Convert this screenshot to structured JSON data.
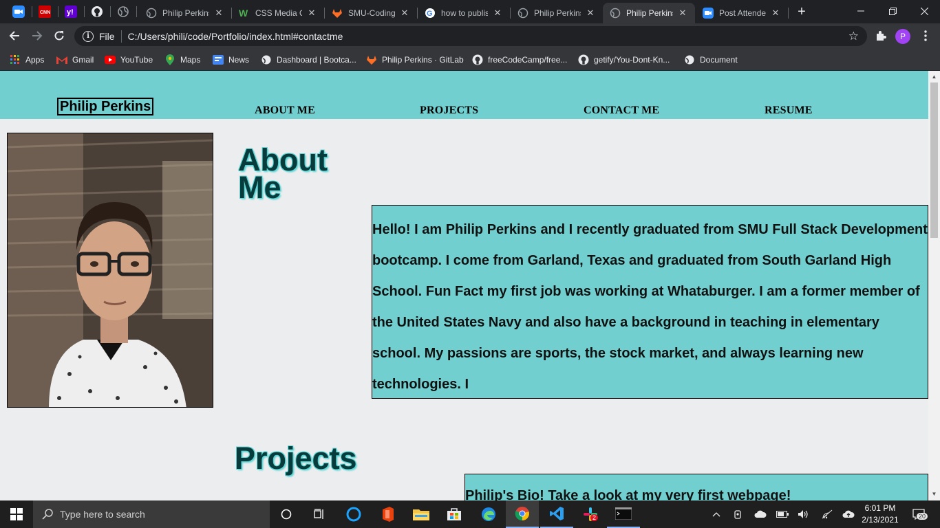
{
  "browser": {
    "tabs": [
      {
        "title": "Philip Perkins",
        "active": false
      },
      {
        "title": "CSS Media Q",
        "active": false
      },
      {
        "title": "SMU-Coding",
        "active": false
      },
      {
        "title": "how to publis",
        "active": false
      },
      {
        "title": "Philip Perkins",
        "active": false
      },
      {
        "title": "Philip Perkins",
        "active": true
      },
      {
        "title": "Post Attende",
        "active": false
      }
    ],
    "address": {
      "scheme": "File",
      "url": "C:/Users/phili/code/Portfolio/index.html#contactme"
    },
    "profile_initial": "P",
    "bookmarks": [
      {
        "label": "Apps"
      },
      {
        "label": "Gmail"
      },
      {
        "label": "YouTube"
      },
      {
        "label": "Maps"
      },
      {
        "label": "News"
      },
      {
        "label": "Dashboard | Bootca..."
      },
      {
        "label": "Philip Perkins · GitLab"
      },
      {
        "label": "freeCodeCamp/free..."
      },
      {
        "label": "getify/You-Dont-Kn..."
      },
      {
        "label": "Document"
      }
    ]
  },
  "page": {
    "logo": "Philip Perkins",
    "nav": [
      "ABOUT ME",
      "PROJECTS",
      "CONTACT ME",
      "RESUME"
    ],
    "about_title": "About Me",
    "about_text": "Hello! I am Philip Perkins and I recently graduated from SMU Full Stack Development bootcamp. I come from Garland, Texas and graduated from South Garland High School. Fun Fact my first job was working at Whataburger. I am a former member of the United States Navy and also have a background in teaching in elementary school. My passions are sports, the stock market, and always learning new technologies. I",
    "projects_title": "Projects",
    "project_caption": "Philip's Bio! Take a look at my very first webpage!"
  },
  "taskbar": {
    "search_placeholder": "Type here to search",
    "time": "6:01 PM",
    "date": "2/13/2021",
    "slack_badge": "2",
    "notifications": "20"
  },
  "colors": {
    "header_teal": "#72cfcf",
    "page_bg": "#ecedee",
    "chrome_dark": "#202124",
    "chrome_toolbar": "#35363a"
  }
}
